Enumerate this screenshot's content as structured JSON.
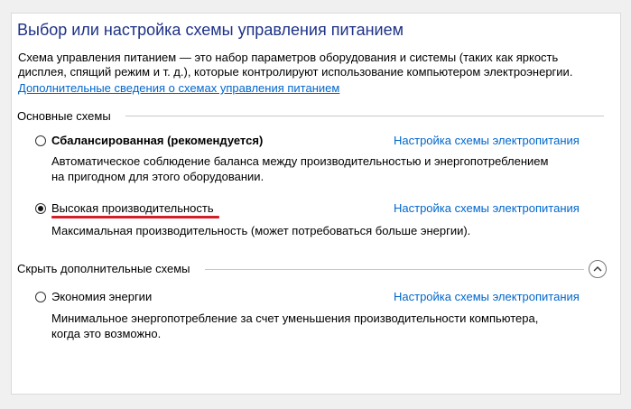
{
  "header": {
    "title": "Выбор или настройка схемы управления питанием",
    "description_line1": "Схема управления питанием — это набор параметров оборудования и системы (таких как яркость",
    "description_line2": "дисплея, спящий режим и т. д.), которые контролируют использование компьютером электроэнергии.",
    "more_info_link": "Дополнительные сведения о схемах управления питанием"
  },
  "main_plans": {
    "label": "Основные схемы",
    "plans": [
      {
        "name": "Сбалансированная (рекомендуется)",
        "selected": false,
        "settings_link": "Настройка схемы электропитания",
        "description_line1": "Автоматическое соблюдение баланса между производительностью и энергопотреблением",
        "description_line2": "на пригодном для этого оборудовании."
      },
      {
        "name": "Высокая производительность",
        "selected": true,
        "settings_link": "Настройка схемы электропитания",
        "description_line1": "Максимальная производительность (может потребоваться больше энергии)."
      }
    ]
  },
  "additional_plans": {
    "label": "Скрыть дополнительные схемы",
    "plans": [
      {
        "name": "Экономия энергии",
        "selected": false,
        "settings_link": "Настройка схемы электропитания",
        "description_line1": "Минимальное энергопотребление за счет уменьшения производительности компьютера,",
        "description_line2": "когда это возможно."
      }
    ]
  },
  "colors": {
    "title": "#1e3287",
    "link": "#0066cc",
    "highlight_underline": "#d2202a"
  },
  "icons": {
    "collapse": "chevron-up-icon"
  }
}
